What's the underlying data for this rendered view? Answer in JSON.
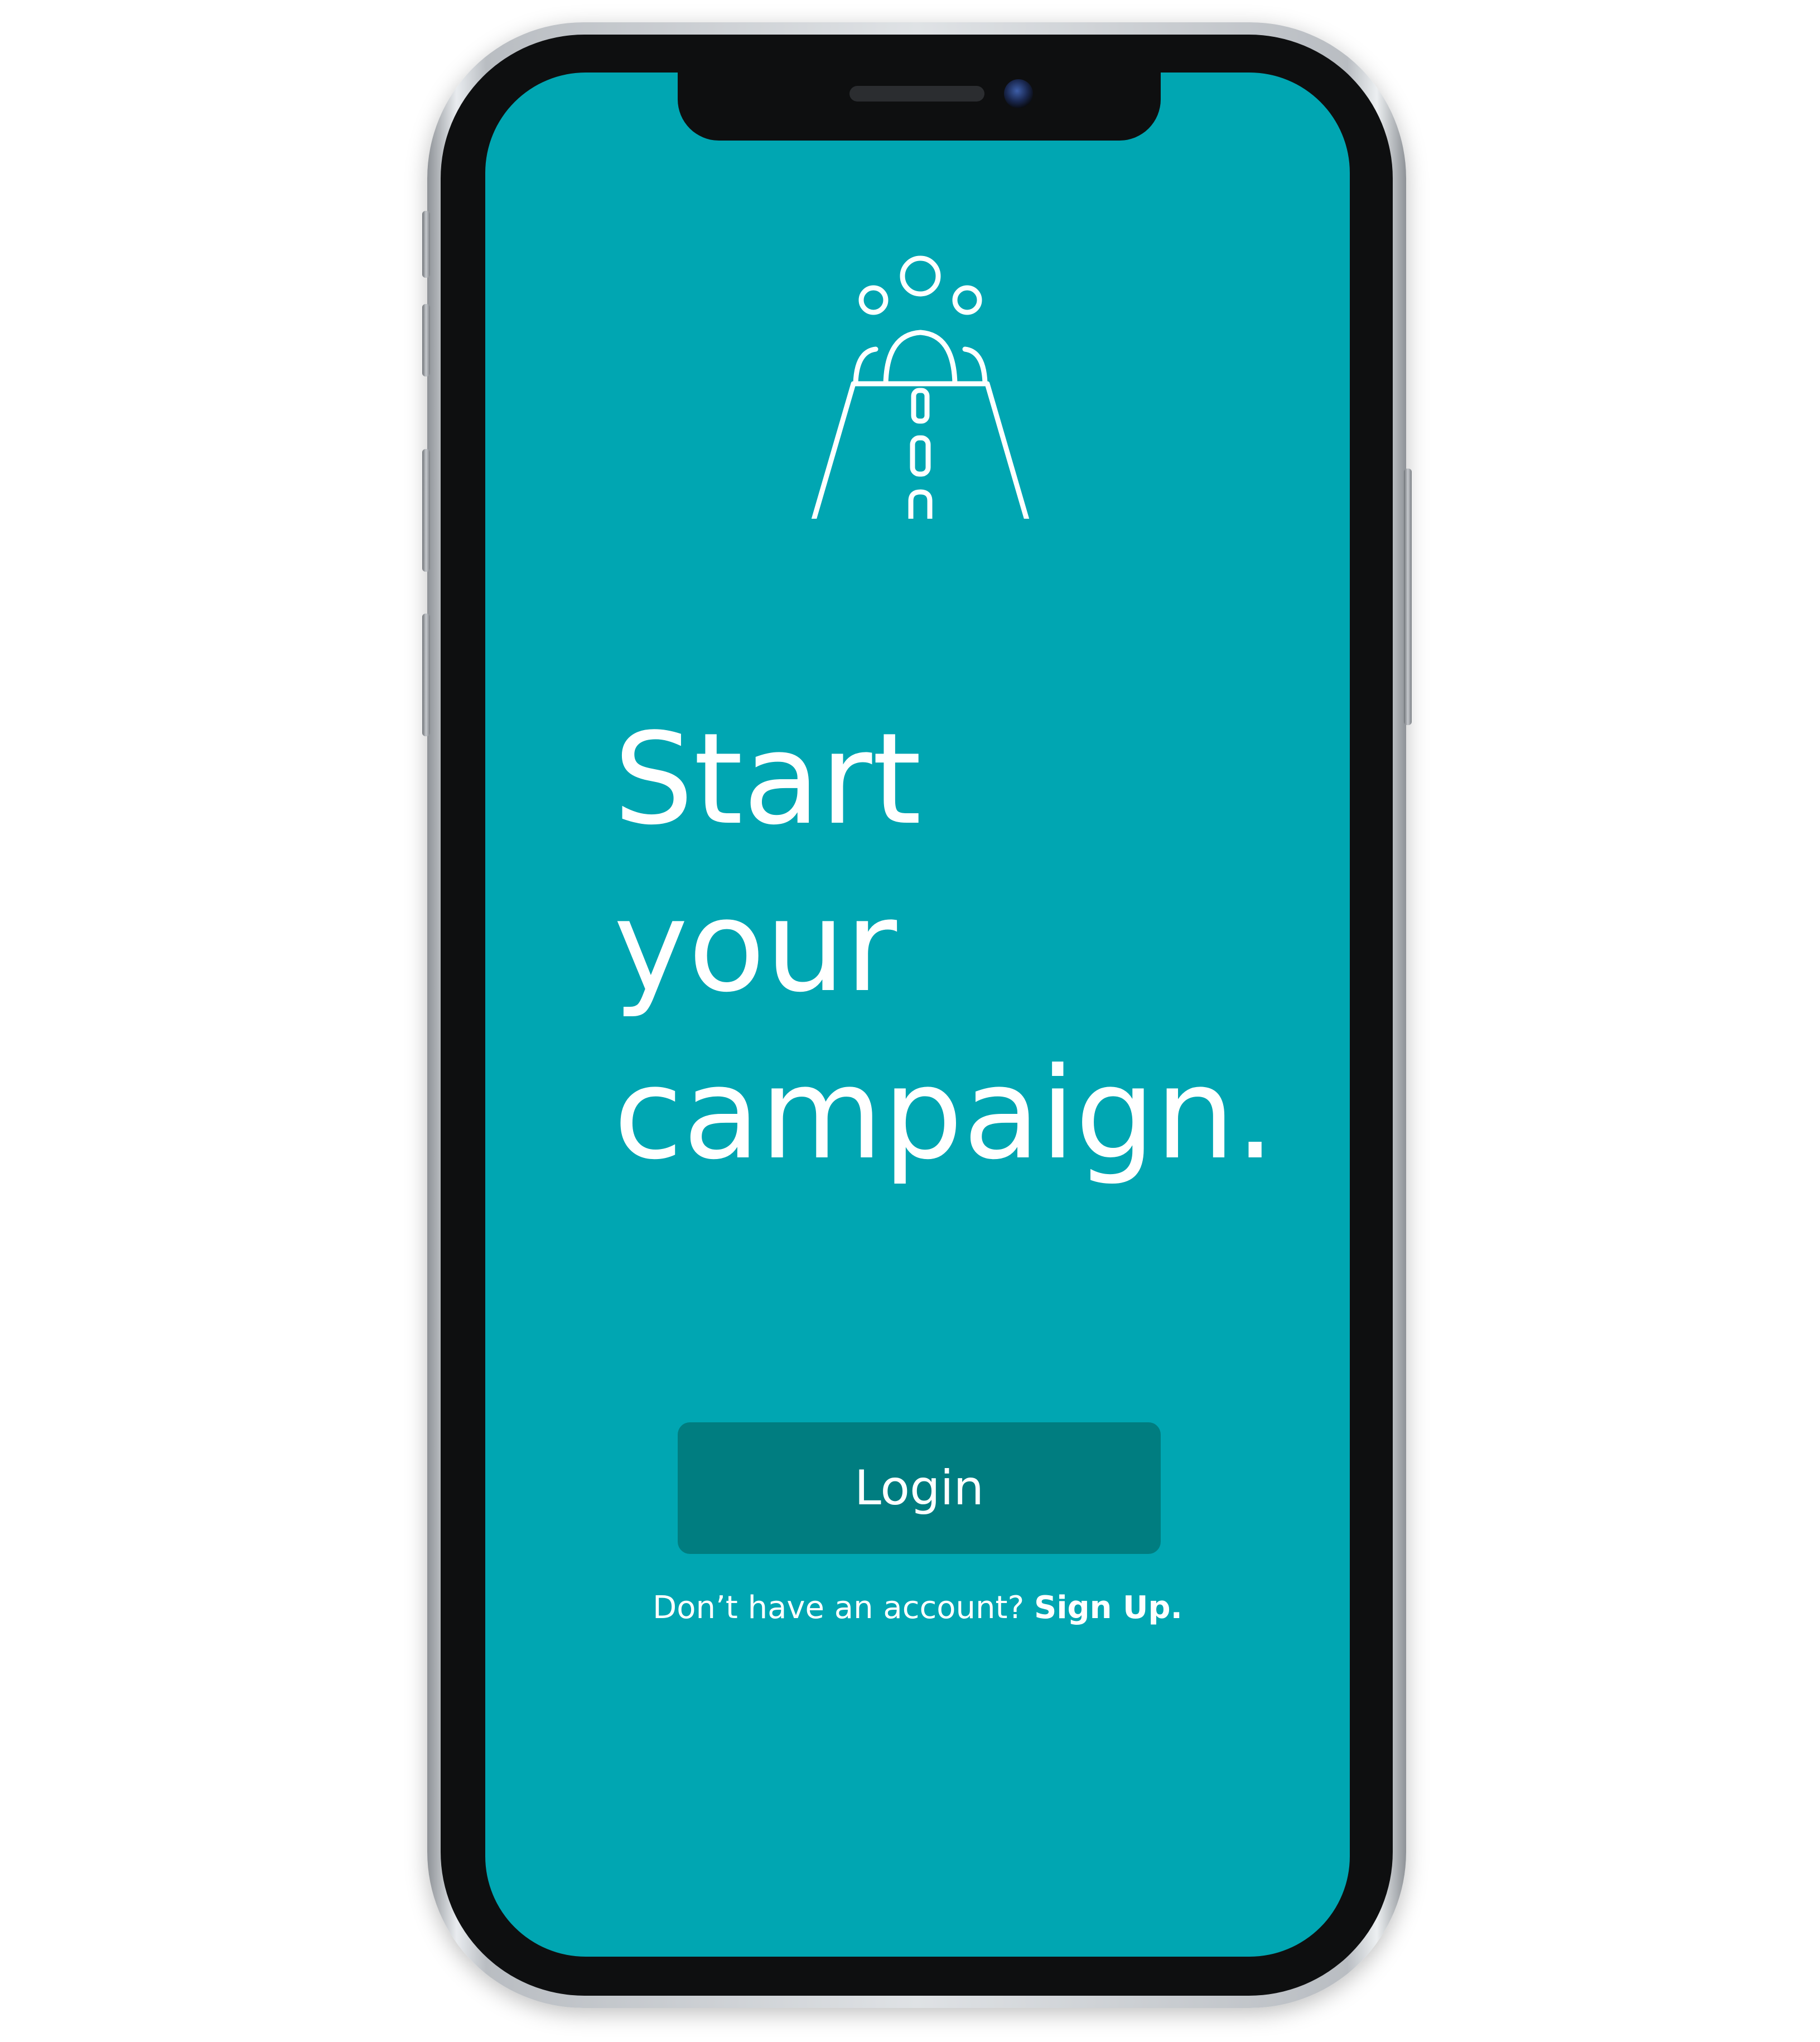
{
  "app": {
    "headline_lines": [
      "Start",
      "your",
      "campaign."
    ],
    "login_label": "Login",
    "signup_prompt": "Don’t have an account?",
    "signup_link": "Sign Up.",
    "logo_icon": "campaign-road-icon"
  },
  "colors": {
    "screen_background": "#00a6b2",
    "button_background": "#007d80",
    "text": "#ffffff"
  }
}
